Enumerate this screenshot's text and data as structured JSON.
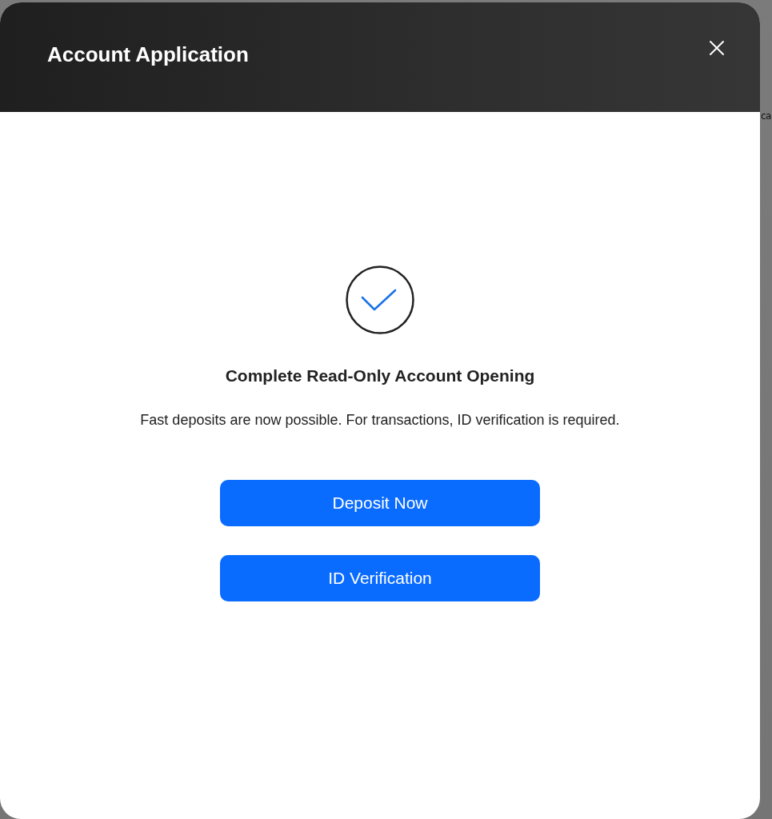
{
  "background_text": "ca",
  "dialog": {
    "title": "Account Application",
    "heading": "Complete Read-Only Account Opening",
    "message": "Fast deposits are now possible. For transactions, ID verification is required.",
    "buttons": [
      {
        "label": "Deposit Now"
      },
      {
        "label": "ID Verification"
      }
    ]
  }
}
